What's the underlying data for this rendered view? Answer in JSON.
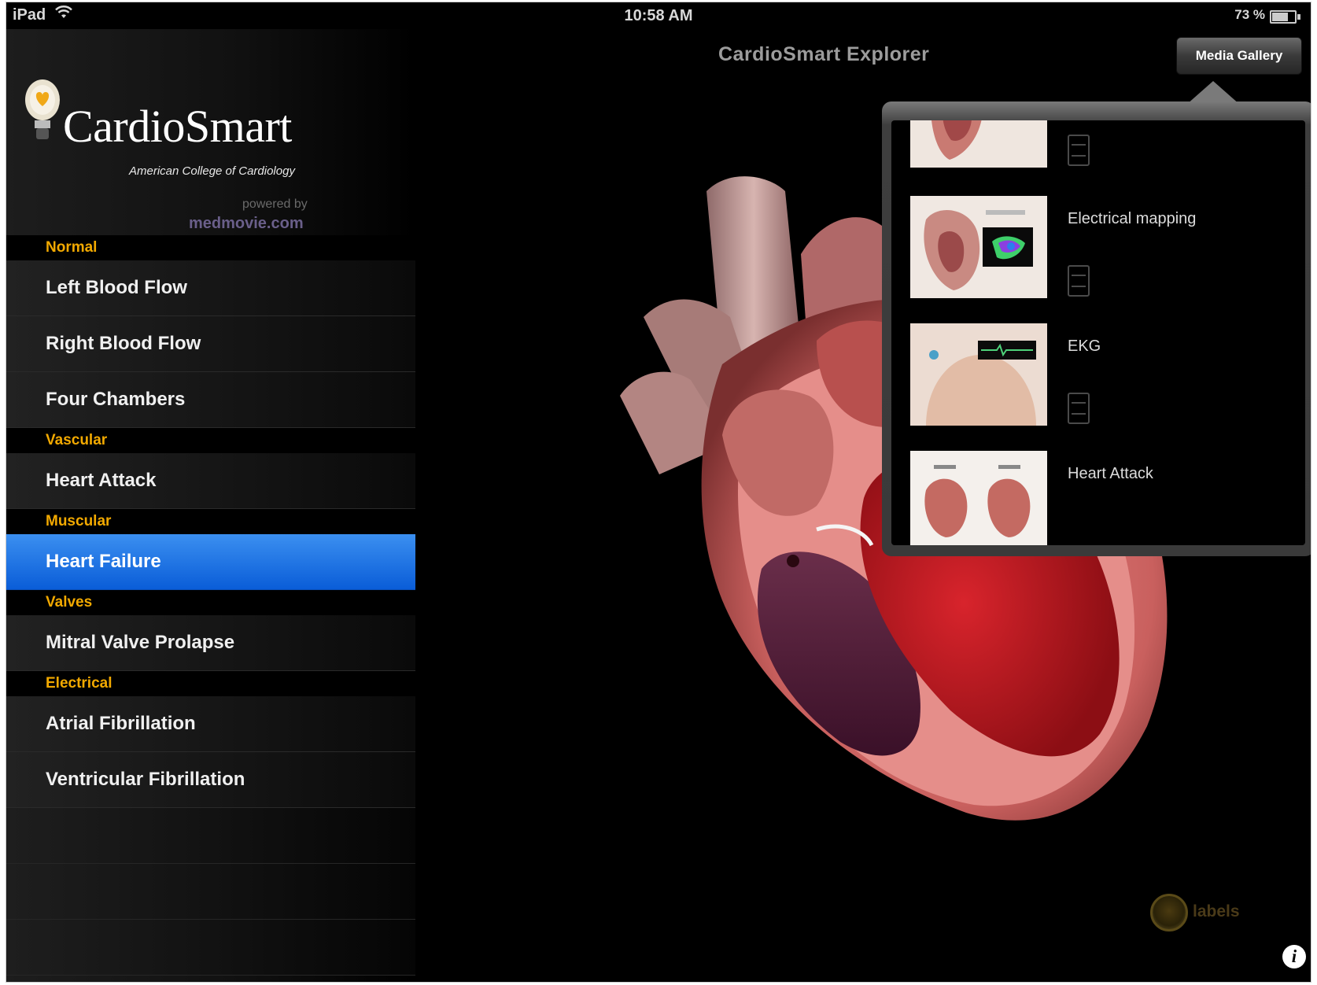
{
  "status_bar": {
    "carrier": "iPad",
    "time": "10:58 AM",
    "battery": "73 %"
  },
  "header": {
    "title": "CardioSmart Explorer",
    "media_gallery_label": "Media Gallery"
  },
  "logo": {
    "brand": "CardioSmart",
    "subtitle": "American College of Cardiology",
    "powered_by": "powered by",
    "medmovie": "medmovie.com"
  },
  "menu": {
    "sections": [
      {
        "title": "Normal",
        "items": [
          "Left Blood Flow",
          "Right Blood Flow",
          "Four Chambers"
        ]
      },
      {
        "title": "Vascular",
        "items": [
          "Heart Attack"
        ]
      },
      {
        "title": "Muscular",
        "items": [
          "Heart Failure"
        ]
      },
      {
        "title": "Valves",
        "items": [
          "Mitral Valve Prolapse"
        ]
      },
      {
        "title": "Electrical",
        "items": [
          "Atrial Fibrillation",
          "Ventricular Fibrillation"
        ]
      }
    ],
    "selected": "Heart Failure"
  },
  "gallery": {
    "items": [
      {
        "label": ""
      },
      {
        "label": "Electrical mapping"
      },
      {
        "label": "EKG"
      },
      {
        "label": "Heart Attack"
      }
    ]
  },
  "controls": {
    "labels_toggle": "labels",
    "info": "i"
  },
  "colors": {
    "section_header": "#f2a900",
    "selected_row": "#1a6ee6",
    "background": "#000000"
  }
}
